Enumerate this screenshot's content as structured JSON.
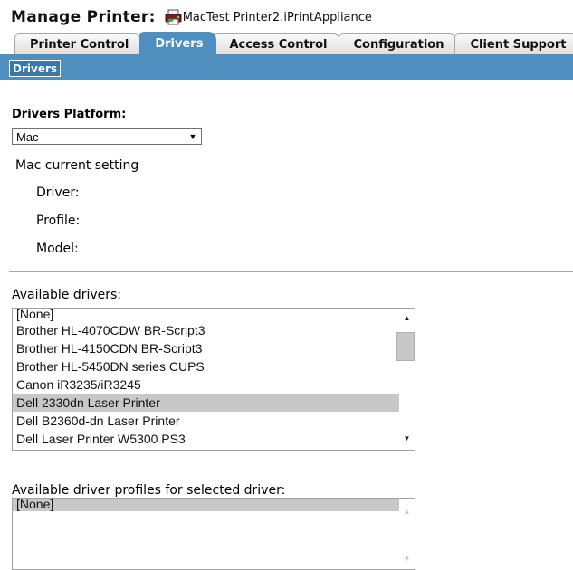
{
  "header": {
    "title": "Manage Printer:",
    "printer_name": "MacTest Printer2.iPrintAppliance",
    "printer_icon": "printer-icon"
  },
  "tabs": [
    {
      "label": "Printer Control",
      "active": false
    },
    {
      "label": "Drivers",
      "active": true
    },
    {
      "label": "Access Control",
      "active": false
    },
    {
      "label": "Configuration",
      "active": false
    },
    {
      "label": "Client Support",
      "active": false
    }
  ],
  "subtabs": [
    {
      "label": "Drivers",
      "active": true
    }
  ],
  "platform": {
    "heading": "Drivers Platform:",
    "selected": "Mac"
  },
  "current_setting": {
    "heading": "Mac current setting",
    "fields": [
      {
        "label": "Driver:",
        "value": ""
      },
      {
        "label": "Profile:",
        "value": ""
      },
      {
        "label": "Model:",
        "value": ""
      }
    ]
  },
  "available_drivers": {
    "label": "Available drivers:",
    "items": [
      "[None]",
      "Brother HL-4070CDW BR-Script3",
      "Brother HL-4150CDN BR-Script3",
      "Brother HL-5450DN series CUPS",
      "Canon iR3235/iR3245",
      "Dell 2330dn Laser Printer",
      "Dell B2360d-dn Laser Printer",
      "Dell Laser Printer W5300 PS3"
    ],
    "selected": "Dell 2330dn Laser Printer"
  },
  "available_profiles": {
    "label": "Available driver profiles for selected driver:",
    "items": [
      "[None]"
    ],
    "selected": "[None]"
  },
  "colors": {
    "tab_active": "#4f8fc0",
    "selection": "#c8c8c8"
  }
}
